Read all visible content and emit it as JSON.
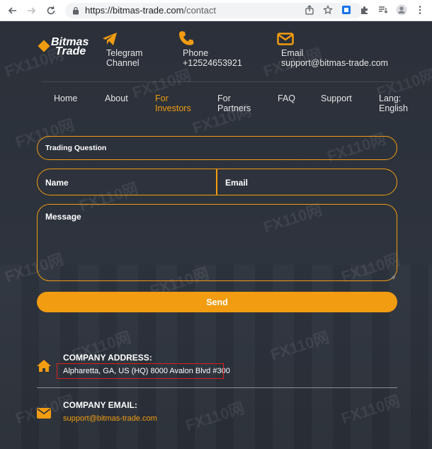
{
  "browser": {
    "url_host": "https://bitmas-trade.com",
    "url_path": "/contact"
  },
  "logo": {
    "line1": "Bitmas",
    "line2": "Trade"
  },
  "contacts": [
    {
      "icon": "paper-plane-icon",
      "line1": "Telegram",
      "line2": "Channel"
    },
    {
      "icon": "phone-icon",
      "line1": "Phone",
      "line2": "+12524653921"
    },
    {
      "icon": "envelope-icon",
      "line1": "Email",
      "line2": "support@bitmas-trade.com"
    }
  ],
  "nav": [
    {
      "line1": "Home",
      "line2": ""
    },
    {
      "line1": "About",
      "line2": ""
    },
    {
      "line1": "For",
      "line2": "Investors",
      "active": true
    },
    {
      "line1": "For",
      "line2": "Partners"
    },
    {
      "line1": "FAQ",
      "line2": ""
    },
    {
      "line1": "Support",
      "line2": ""
    },
    {
      "line1": "Lang:",
      "line2": "English"
    }
  ],
  "form": {
    "subject_value": "Trading Question",
    "name_placeholder": "Name",
    "email_placeholder": "Email",
    "message_placeholder": "Message",
    "send_label": "Send"
  },
  "company": {
    "address_title": "COMPANY ADDRESS:",
    "address_value": "Alpharetta, GA, US (HQ) 8000 Avalon Blvd #300",
    "email_title": "COMPANY EMAIL:",
    "email_value": "support@bitmas-trade.com"
  },
  "watermark": "FX110网",
  "colors": {
    "accent": "#f29c11",
    "background": "#2b3039",
    "highlight": "#d92020"
  }
}
